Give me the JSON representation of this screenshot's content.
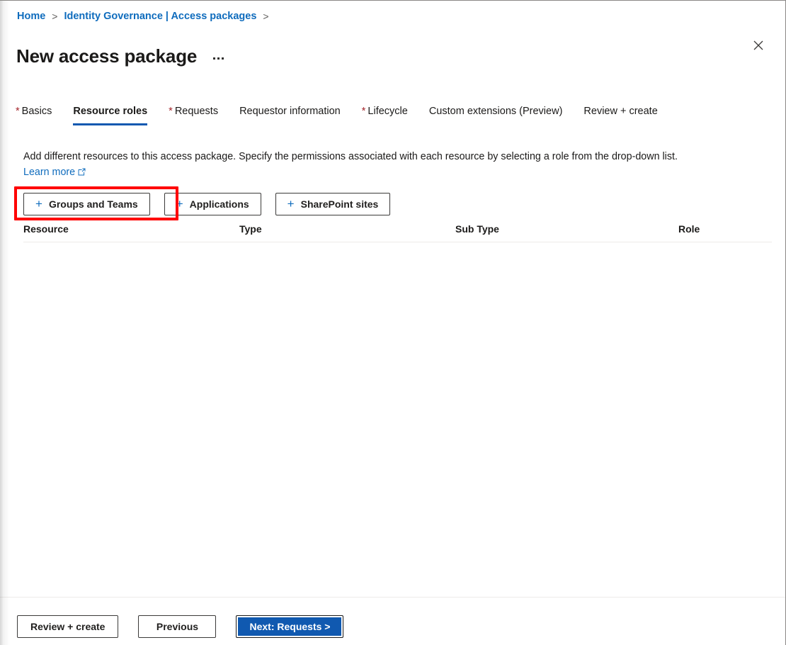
{
  "breadcrumb": {
    "items": [
      {
        "label": "Home",
        "separator": ">"
      },
      {
        "label": "Identity Governance | Access packages",
        "separator": ">"
      }
    ]
  },
  "header": {
    "title": "New access package",
    "more_menu_label": "...",
    "close_label": "Close"
  },
  "tabs": [
    {
      "label": "Basics",
      "required": true,
      "selected": false
    },
    {
      "label": "Resource roles",
      "required": false,
      "selected": true
    },
    {
      "label": "Requests",
      "required": true,
      "selected": false
    },
    {
      "label": "Requestor information",
      "required": false,
      "selected": false
    },
    {
      "label": "Lifecycle",
      "required": true,
      "selected": false
    },
    {
      "label": "Custom extensions (Preview)",
      "required": false,
      "selected": false
    },
    {
      "label": "Review + create",
      "required": false,
      "selected": false
    }
  ],
  "description": {
    "text": "Add different resources to this access package. Specify the permissions associated with each resource by selecting a role from the drop-down list.",
    "link_label": "Learn more"
  },
  "resource_buttons": [
    {
      "label": "Groups and Teams",
      "icon": "plus-icon",
      "highlighted": true
    },
    {
      "label": "Applications",
      "icon": "plus-icon",
      "highlighted": false
    },
    {
      "label": "SharePoint sites",
      "icon": "plus-icon",
      "highlighted": false
    }
  ],
  "table": {
    "columns": [
      "Resource",
      "Type",
      "Sub Type",
      "Role"
    ],
    "rows": []
  },
  "footer": {
    "review_create_label": "Review + create",
    "previous_label": "Previous",
    "next_label": "Next: Requests >"
  },
  "colors": {
    "link_blue": "#0f6cbd",
    "accent_blue": "#1059b0",
    "required_red": "#a4262c",
    "highlight_red": "#ff0000",
    "text_primary": "#1b1a19"
  },
  "required_marker": "*"
}
